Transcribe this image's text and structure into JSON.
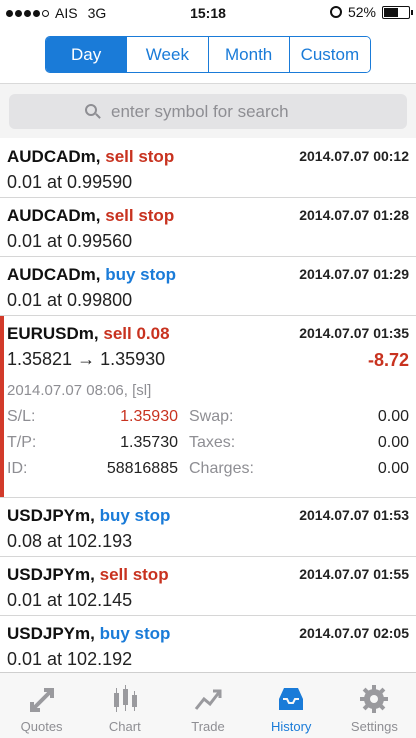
{
  "status_bar": {
    "carrier": "AIS",
    "network": "3G",
    "time": "15:18",
    "battery": "52%",
    "battery_level": 0.52
  },
  "segments": [
    {
      "label": "Day",
      "active": true
    },
    {
      "label": "Week",
      "active": false
    },
    {
      "label": "Month",
      "active": false
    },
    {
      "label": "Custom",
      "active": false
    }
  ],
  "search": {
    "placeholder": "enter symbol for search"
  },
  "orders": [
    {
      "symbol": "AUDCADm,",
      "type": "sell stop",
      "side": "sell",
      "time": "2014.07.07 00:12",
      "detail": "0.01 at 0.99590"
    },
    {
      "symbol": "AUDCADm,",
      "type": "sell stop",
      "side": "sell",
      "time": "2014.07.07 01:28",
      "detail": "0.01 at 0.99560"
    },
    {
      "symbol": "AUDCADm,",
      "type": "buy stop",
      "side": "buy",
      "time": "2014.07.07 01:29",
      "detail": "0.01 at 0.99800"
    }
  ],
  "expanded_order": {
    "symbol": "EURUSDm,",
    "type": "sell 0.08",
    "time": "2014.07.07 01:35",
    "prices": "1.35821 → 1.35930",
    "profit": "-8.72",
    "open_info": "2014.07.07 08:06, [sl]",
    "sl_label": "S/L:",
    "sl_value": "1.35930",
    "tp_label": "T/P:",
    "tp_value": "1.35730",
    "id_label": "ID:",
    "id_value": "58816885",
    "swap_label": "Swap:",
    "swap_value": "0.00",
    "taxes_label": "Taxes:",
    "taxes_value": "0.00",
    "charges_label": "Charges:",
    "charges_value": "0.00"
  },
  "orders_after": [
    {
      "symbol": "USDJPYm,",
      "type": "buy stop",
      "side": "buy",
      "time": "2014.07.07 01:53",
      "detail": "0.08 at 102.193"
    },
    {
      "symbol": "USDJPYm,",
      "type": "sell stop",
      "side": "sell",
      "time": "2014.07.07 01:55",
      "detail": "0.01 at 102.145"
    },
    {
      "symbol": "USDJPYm,",
      "type": "buy stop",
      "side": "buy",
      "time": "2014.07.07 02:05",
      "detail": "0.01 at 102.192"
    }
  ],
  "tabs": [
    {
      "label": "Quotes",
      "icon": "quotes-icon",
      "active": false
    },
    {
      "label": "Chart",
      "icon": "chart-icon",
      "active": false
    },
    {
      "label": "Trade",
      "icon": "trade-icon",
      "active": false
    },
    {
      "label": "History",
      "icon": "history-icon",
      "active": true
    },
    {
      "label": "Settings",
      "icon": "settings-icon",
      "active": false
    }
  ],
  "colors": {
    "accent": "#1a7bd8",
    "sell": "#c8321f",
    "buy": "#1a7bd8",
    "muted": "#8e8e93"
  }
}
